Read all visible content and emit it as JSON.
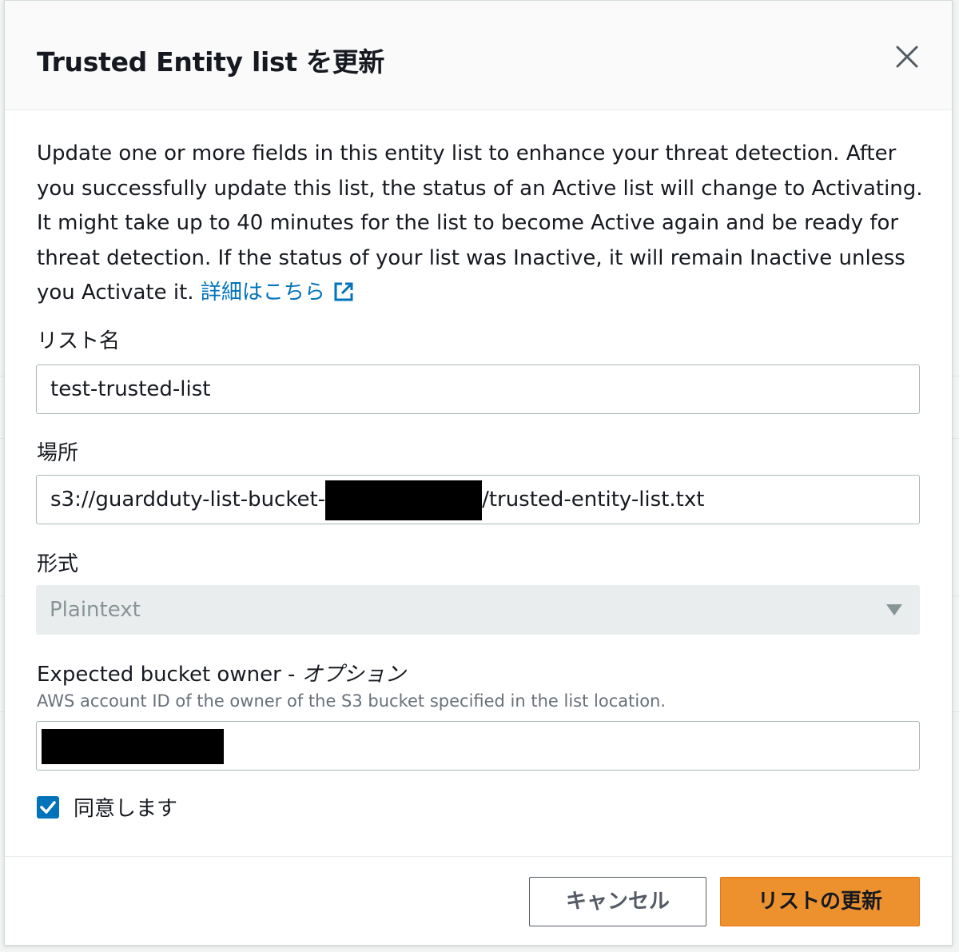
{
  "modal": {
    "title": "Trusted Entity list を更新",
    "description": "Update one or more fields in this entity list to enhance your threat detection. After you successfully update this list, the status of an Active list will change to Activating. It might take up to 40 minutes for the list to become Active again and be ready for threat detection. If the status of your list was Inactive, it will remain Inactive unless you Activate it.",
    "learn_more": "詳細はこちら"
  },
  "fields": {
    "name": {
      "label": "リスト名",
      "value": "test-trusted-list"
    },
    "location": {
      "label": "場所",
      "value_prefix": "s3://guardduty-list-bucket-",
      "value_suffix": "/trusted-entity-list.txt"
    },
    "format": {
      "label": "形式",
      "selected": "Plaintext"
    },
    "bucket_owner": {
      "label": "Expected bucket owner - ",
      "label_optional": "オプション",
      "description": "AWS account ID of the owner of the S3 bucket specified in the list location."
    },
    "agree": {
      "label": "同意します",
      "checked": true
    }
  },
  "buttons": {
    "cancel": "キャンセル",
    "submit": "リストの更新"
  },
  "colors": {
    "primary": "#ec912d",
    "link": "#0073bb",
    "checkbox": "#0073bb"
  },
  "icons": [
    "close-icon",
    "external-link-icon",
    "caret-down-icon",
    "check-icon"
  ]
}
